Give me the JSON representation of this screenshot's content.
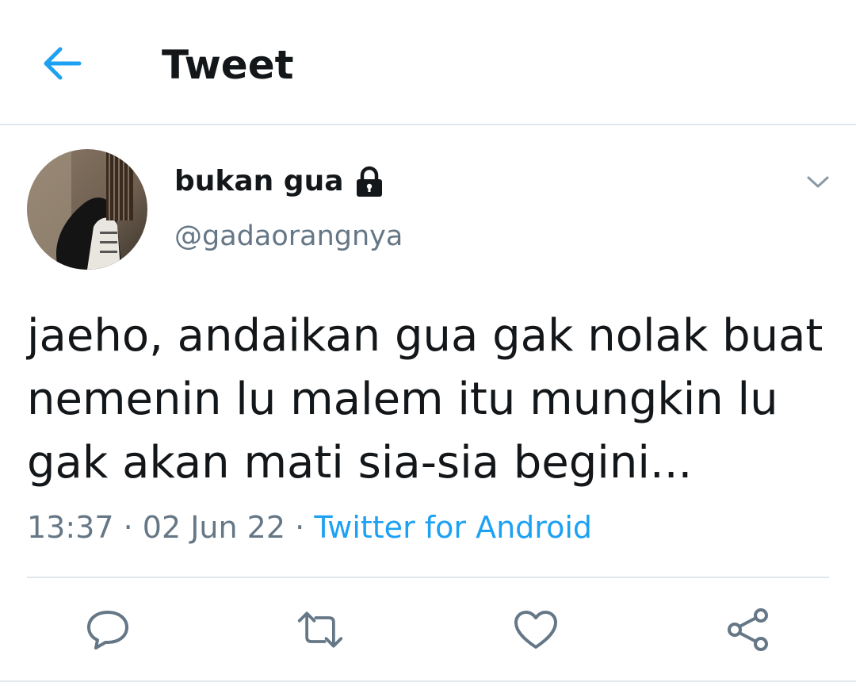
{
  "header": {
    "back_icon": "arrow-left-icon",
    "title": "Tweet"
  },
  "tweet": {
    "author": {
      "display_name": "bukan gua",
      "handle": "@gadaorangnya",
      "protected_icon": "lock-icon",
      "avatar": "guitar-photo-avatar"
    },
    "more_icon": "chevron-down-icon",
    "text": "jaeho, andaikan gua gak nolak buat\nnemenin lu malem itu mungkin lu\ngak akan mati sia-sia begini...",
    "time": "13:37",
    "date": "02 Jun 22",
    "separator": "·",
    "source": "Twitter for Android"
  },
  "actions": [
    {
      "name": "reply",
      "icon": "reply-icon"
    },
    {
      "name": "retweet",
      "icon": "retweet-icon"
    },
    {
      "name": "like",
      "icon": "heart-icon"
    },
    {
      "name": "share",
      "icon": "share-icon"
    }
  ],
  "colors": {
    "accent": "#1da1f2",
    "text": "#14171a",
    "muted": "#657786",
    "divider": "#e1e8ed"
  }
}
